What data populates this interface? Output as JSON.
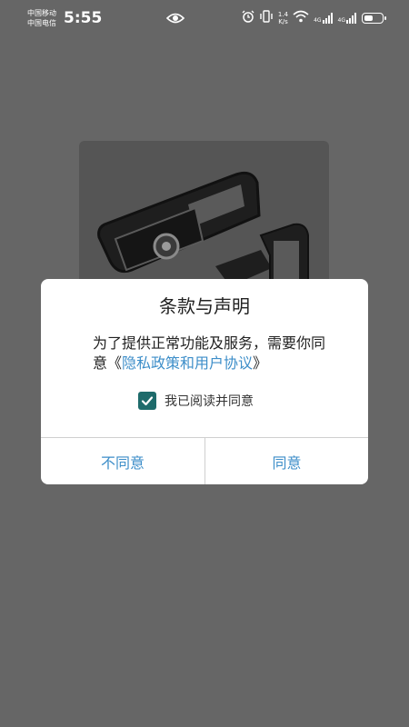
{
  "status_bar": {
    "carrier_1": "中国移动",
    "carrier_2": "中国电信",
    "time": "5:55",
    "speed_value": "1.4",
    "speed_unit": "K/s",
    "net_1": "4G",
    "net_2": "4G",
    "battery_level": 0.55
  },
  "dialog": {
    "title": "条款与声明",
    "message_prefix": "为了提供正常功能及服务，需要你同意《",
    "message_link": "隐私政策和用户协议",
    "message_suffix": "》",
    "agree_label": "我已阅读并同意",
    "agree_checked": true,
    "disagree_button": "不同意",
    "agree_button": "同意"
  },
  "colors": {
    "link": "#3d8ec9",
    "checkbox": "#1e6b6b",
    "overlay": "#666666"
  }
}
